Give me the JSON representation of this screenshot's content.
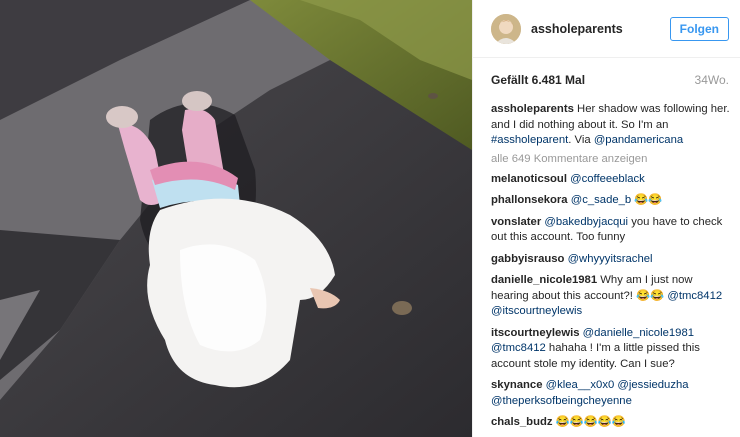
{
  "post": {
    "owner_username": "assholeparents",
    "follow_label": "Folgen",
    "likes_label": "Gefällt 6.481 Mal",
    "age_label": "34Wo.",
    "caption": {
      "username": "assholeparents",
      "text": "Her shadow was following her. and I did nothing about it. So I'm an",
      "hashtag": "#assholeparent",
      "text_2": ". Via",
      "mention": "@pandamericana"
    },
    "load_more_label": "alle 649 Kommentare anzeigen",
    "comments": [
      {
        "username": "melanoticsoul",
        "parts": [
          {
            "mention": "@coffeeeblack"
          }
        ]
      },
      {
        "username": "phallonsekora",
        "parts": [
          {
            "mention": "@c_sade_b"
          },
          {
            "text": " 😂😂"
          }
        ]
      },
      {
        "username": "vonslater",
        "parts": [
          {
            "mention": "@bakedbyjacqui"
          },
          {
            "text": " you have to check out this account. Too funny"
          }
        ]
      },
      {
        "username": "gabbyisrauso",
        "parts": [
          {
            "mention": "@whyyyitsrachel"
          }
        ]
      },
      {
        "username": "danielle_nicole1981",
        "parts": [
          {
            "text": "Why am I just now hearing about this account?! 😂😂 "
          },
          {
            "mention": "@tmc8412"
          },
          {
            "text": " "
          },
          {
            "mention": "@itscourtneylewis"
          }
        ]
      },
      {
        "username": "itscourtneylewis",
        "parts": [
          {
            "mention": "@danielle_nicole1981"
          },
          {
            "text": " "
          },
          {
            "mention": "@tmc8412"
          },
          {
            "text": " hahaha ! I'm a little pissed this account stole my identity. Can I sue?"
          }
        ]
      },
      {
        "username": "skynance",
        "parts": [
          {
            "mention": "@klea__x0x0"
          },
          {
            "text": " "
          },
          {
            "mention": "@jessieduzha"
          },
          {
            "text": " "
          },
          {
            "mention": "@theperksofbeingcheyenne"
          }
        ]
      },
      {
        "username": "chals_budz",
        "parts": [
          {
            "text": "😂😂😂😂😂"
          }
        ]
      }
    ]
  },
  "icons": {
    "avatar": "profile-avatar",
    "photo": "post-photo"
  },
  "colors": {
    "link": "#003569",
    "follow": "#3897f0",
    "muted": "#999999",
    "text": "#262626"
  }
}
